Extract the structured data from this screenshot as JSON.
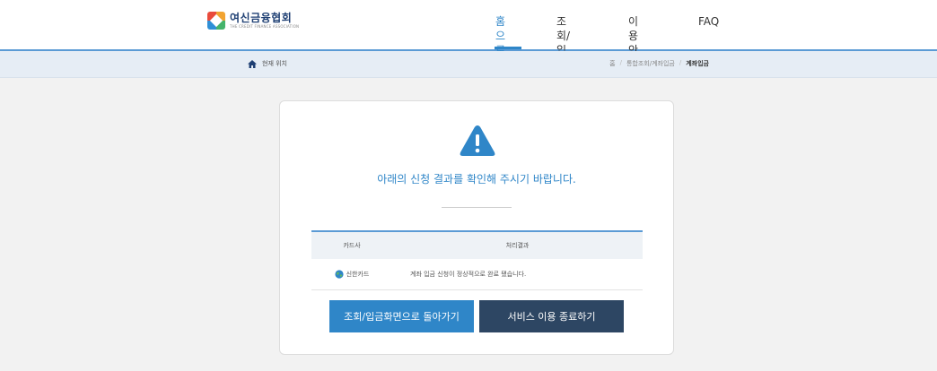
{
  "header": {
    "logo_ko": "여신금융협회",
    "logo_en": "THE CREDIT FINANCE ASSOCIATION",
    "nav": [
      {
        "label": "홈으로",
        "active": true
      },
      {
        "label": "조회/입금",
        "active": false
      },
      {
        "label": "이용안내",
        "active": false
      },
      {
        "label": "FAQ",
        "active": false
      }
    ]
  },
  "breadcrumb": {
    "location_label": "현재 위치",
    "items": [
      "홈",
      "통합조회/계좌입금",
      "계좌입금"
    ]
  },
  "result": {
    "icon": "warning-icon",
    "message": "아래의 신청 결과를 확인해 주시기 바랍니다.",
    "table": {
      "headers": [
        "카드사",
        "처리결과"
      ],
      "rows": [
        {
          "company": "신한카드",
          "company_icon": "globe-icon",
          "result": "계좌 입금 신청이 정상적으로 완료 됐습니다."
        }
      ]
    },
    "buttons": {
      "back_label": "조회/입금화면으로 돌아가기",
      "end_label": "서비스 이용 종료하기"
    }
  },
  "colors": {
    "accent": "#2f86c8",
    "dark_button": "#2d4663",
    "header_rule": "#5b9bd5",
    "breadcrumb_bg": "#e6edf5",
    "page_bg": "#f2f2f2"
  }
}
